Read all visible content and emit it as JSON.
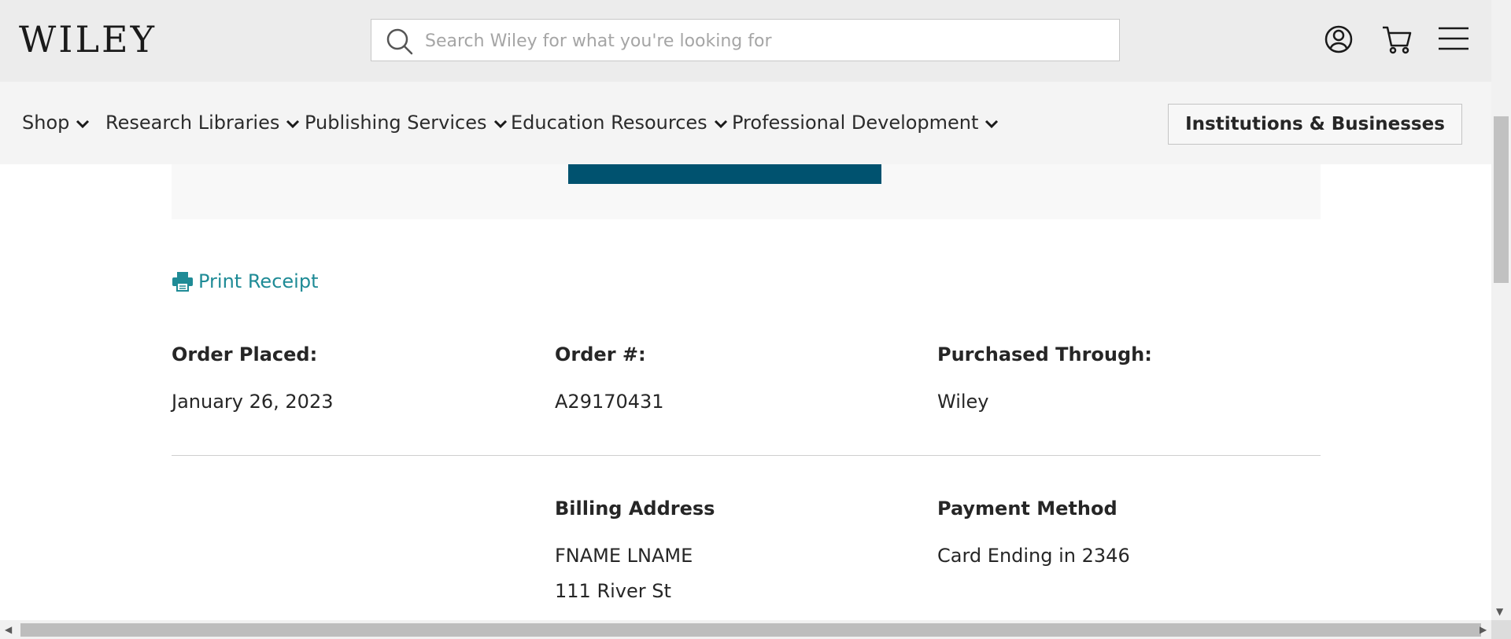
{
  "header": {
    "logo_text": "Wiley",
    "search": {
      "placeholder": "Search Wiley for what you're looking for",
      "value": ""
    },
    "icons": [
      "account-icon",
      "cart-icon",
      "menu-icon"
    ]
  },
  "nav": {
    "items": [
      {
        "label": "Shop"
      },
      {
        "label": "Research Libraries"
      },
      {
        "label": "Publishing Services"
      },
      {
        "label": "Education Resources"
      },
      {
        "label": "Professional Development"
      }
    ],
    "institutions_button": "Institutions & Businesses"
  },
  "order": {
    "print_label": "Print Receipt",
    "placed_label": "Order Placed:",
    "placed_value": "January 26, 2023",
    "number_label": "Order #:",
    "number_value": "A29170431",
    "purchased_label": "Purchased Through:",
    "purchased_value": "Wiley"
  },
  "billing": {
    "label": "Billing Address",
    "name": "FNAME LNAME",
    "street": "111 River St"
  },
  "payment": {
    "label": "Payment Method",
    "value": "Card Ending in 2346"
  },
  "colors": {
    "header_bg": "#ececec",
    "nav_bg": "#f4f4f4",
    "link_teal": "#1f8b96",
    "button_dark_teal": "#00526f"
  }
}
